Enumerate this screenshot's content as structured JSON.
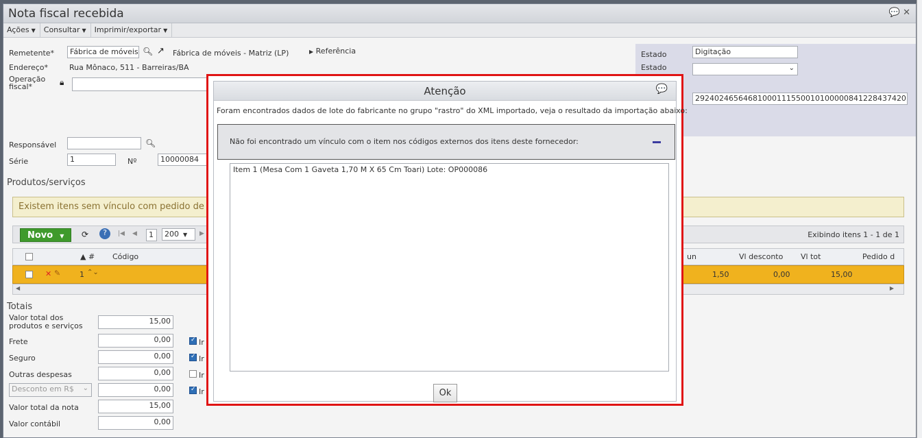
{
  "window": {
    "title": "Nota fiscal recebida"
  },
  "menu": [
    {
      "label": "Ações"
    },
    {
      "label": "Consultar"
    },
    {
      "label": "Imprimir/exportar"
    }
  ],
  "form": {
    "remetente_label": "Remetente*",
    "remetente_value": "Fábrica de móveis",
    "remetente_link": "Fábrica de móveis - Matriz (LP)",
    "referencia": "Referência",
    "endereco_label": "Endereço*",
    "endereco_value": "Rua Mônaco, 511 - Barreiras/BA",
    "operacao_label_1": "Operação",
    "operacao_label_2": "fiscal*",
    "responsavel_label": "Responsável",
    "serie_label": "Série",
    "serie_value": "1",
    "numero_label": "Nº",
    "numero_value": "10000084"
  },
  "right_panel": {
    "estado_label": "Estado",
    "estado_value": "Digitação",
    "estado2_label": "Estado",
    "chave_value": "29240246564681000111550010100000841228437420"
  },
  "products": {
    "section_title": "Produtos/serviços",
    "warning": "Existem itens sem vínculo com pedido de com",
    "novo_label": "Novo",
    "page_value": "1",
    "page_size": "200",
    "exibindo": "Exibindo itens 1 - 1 de 1",
    "headers": {
      "num": "▲ #",
      "codigo": "Código",
      "un": "un",
      "vl_desconto": "Vl desconto",
      "vl_tot": "Vl tot",
      "pedido": "Pedido d"
    },
    "row": {
      "num": "1",
      "un": "1,50",
      "vl_desconto": "0,00",
      "vl_tot": "15,00"
    }
  },
  "totais": {
    "section_title": "Totais",
    "rows": [
      {
        "label1": "Valor total dos",
        "label2": "produtos e serviços",
        "value": "15,00"
      },
      {
        "label1": "Frete",
        "value": "0,00",
        "check": "Ir"
      },
      {
        "label1": "Seguro",
        "value": "0,00",
        "check": "Ir"
      },
      {
        "label1": "Outras despesas",
        "value": "0,00",
        "check": "Ir"
      },
      {
        "label1": "Desconto em R$",
        "value": "0,00",
        "check": "Ir"
      },
      {
        "label1": "Valor total da nota",
        "value": "15,00"
      },
      {
        "label1": "Valor contábil",
        "value": "0,00"
      }
    ]
  },
  "dialog": {
    "title": "Atenção",
    "message": "Foram encontrados dados de lote do fabricante no grupo \"rastro\" do XML importado, veja o resultado da importação abaixo:",
    "panel_title": "Não foi encontrado um vínculo com o item nos códigos externos dos itens deste fornecedor:",
    "content": "Item 1 (Mesa Com 1 Gaveta 1,70 M X 65 Cm Toari) Lote: OP000086",
    "ok_label": "Ok"
  },
  "colors": {
    "accent_red": "#e01414",
    "novo_green": "#3f9a2c",
    "row_selected": "#f0b21e"
  }
}
